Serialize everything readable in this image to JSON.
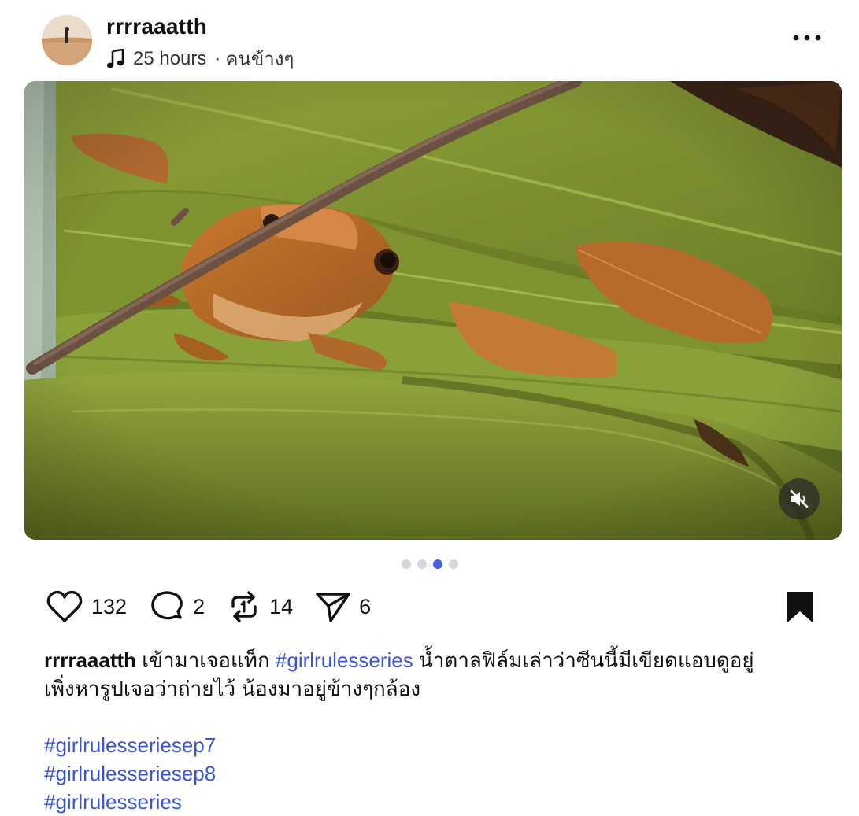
{
  "post": {
    "username": "rrrraaatth",
    "time": "25 hours",
    "separator": "·",
    "audience": "คนข้างๆ",
    "icons": {
      "music": "music-note-icon",
      "more": "more-horizontal-icon",
      "mute": "speaker-muted-icon"
    }
  },
  "media": {
    "type": "video",
    "description_icon": "frog-on-leaf-photo",
    "carousel_total": 4,
    "carousel_active": 3
  },
  "actions": {
    "likes": "132",
    "comments": "2",
    "reposts": "14",
    "shares": "6",
    "saved": true
  },
  "caption": {
    "author": "rrrraaatth",
    "text_before_tag": "เข้ามาเจอแท็ก",
    "inline_tag": "#girlrulesseries",
    "text_after_tag_line1": "น้ำตาลฟิล์มเล่าว่าซีนนี้มีเขียดแอบดูอยู่",
    "text_line2": "เพิ่งหารูปเจอว่าถ่ายไว้ น้องมาอยู่ข้างๆกล้อง",
    "tags": [
      "#girlrulesseriesep7",
      "#girlrulesseriesep8",
      "#girlrulesseries"
    ]
  },
  "colors": {
    "hashtag": "#3b55d9",
    "dot_active": "#4a5ee0",
    "dot_inactive": "#d3d6dc",
    "text": "#111111"
  }
}
